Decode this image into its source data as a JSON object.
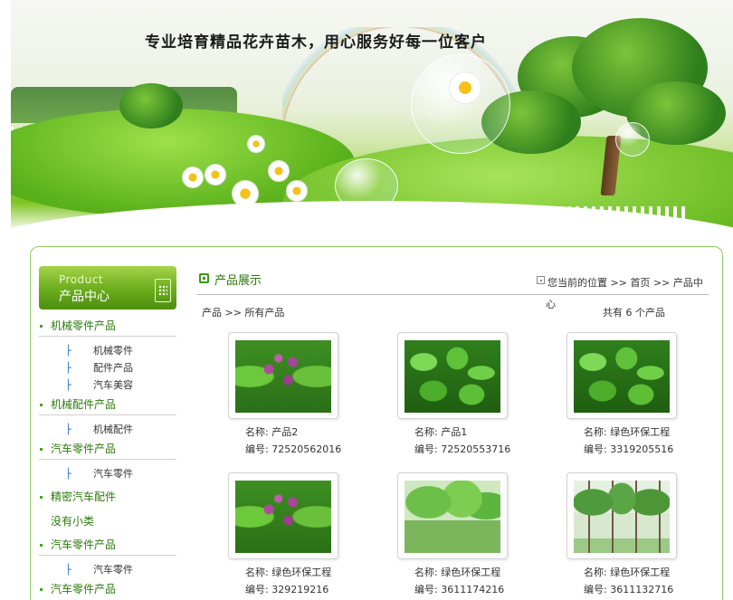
{
  "banner": {
    "slogan": "专业培育精品花卉苗木，用心服务好每一位客户"
  },
  "sidebar": {
    "header_en": "Product",
    "header_cn": "产品中心",
    "categories": [
      {
        "label": "机械零件产品",
        "subs": [
          "机械零件",
          "配件产品",
          "汽车美容"
        ]
      },
      {
        "label": "机械配件产品",
        "subs": [
          "机械配件"
        ]
      },
      {
        "label": "汽车零件产品",
        "subs": [
          "汽车零件"
        ]
      },
      {
        "label": "精密汽车配件",
        "subs": []
      },
      {
        "label": "没有小类",
        "subs": []
      },
      {
        "label": "汽车零件产品",
        "subs": [
          "汽车零件"
        ]
      },
      {
        "label": "汽车零件产品",
        "subs": []
      }
    ]
  },
  "main": {
    "title": "产品展示",
    "location_label": "您当前的位置",
    "breadcrumb_sep": ">>",
    "breadcrumb_home": "首页",
    "breadcrumb_current": "产品中",
    "breadcrumb_wrap": "心",
    "filter_root": "产品",
    "filter_sep": ">>",
    "filter_current": "所有产品",
    "total_text": "共有 6 个产品"
  },
  "products": [
    {
      "name": "名称: 产品2",
      "code": "编号: 72520562016",
      "image": "purple-flower-trees"
    },
    {
      "name": "名称: 产品1",
      "code": "编号: 72520553716",
      "image": "green-leaves"
    },
    {
      "name": "名称: 绿色环保工程",
      "code": "编号: 3319205516",
      "image": "green-leaves"
    },
    {
      "name": "名称: 绿色环保工程",
      "code": "编号: 329219216",
      "image": "purple-flower-trees"
    },
    {
      "name": "名称: 绿色环保工程",
      "code": "编号: 3611174216",
      "image": "willow-trees"
    },
    {
      "name": "名称: 绿色环保工程",
      "code": "编号: 3611132716",
      "image": "row-trees"
    }
  ]
}
